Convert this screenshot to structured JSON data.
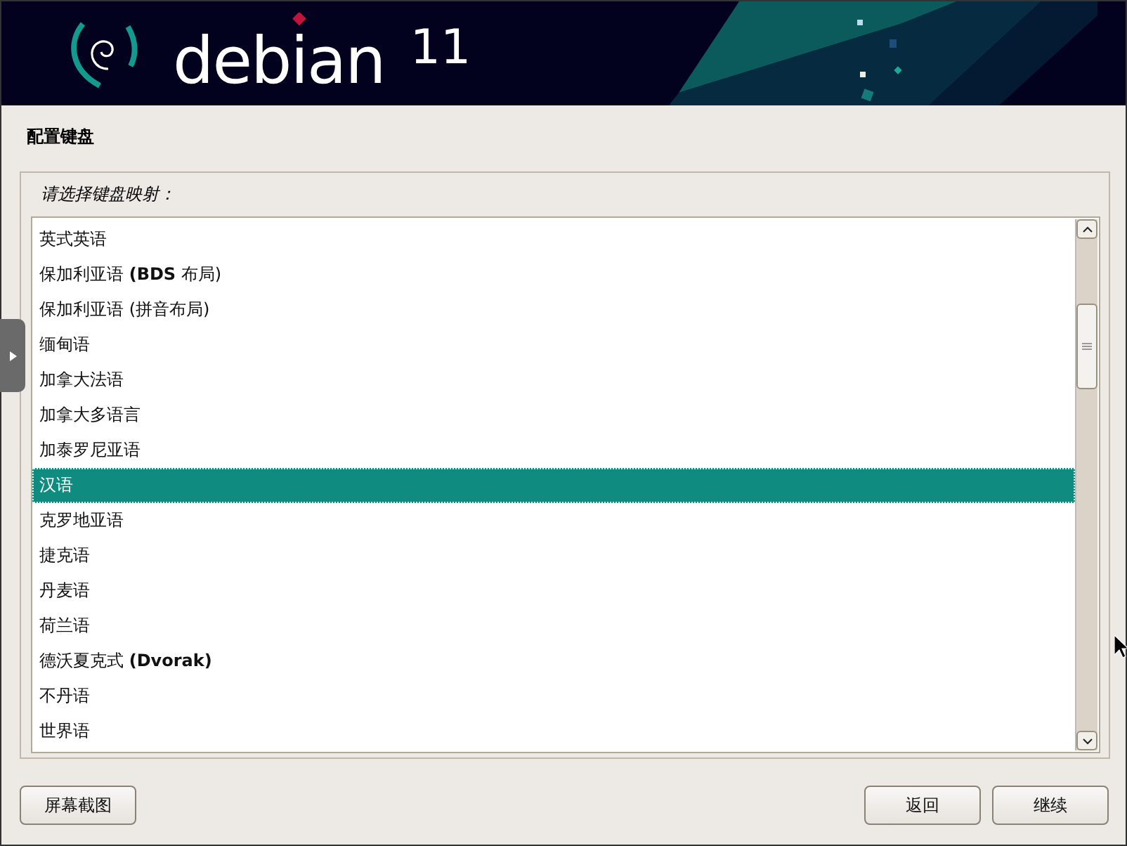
{
  "header": {
    "brand": "debian",
    "version": "11"
  },
  "title": "配置键盘",
  "prompt": "请选择键盘映射：",
  "options": [
    {
      "label": "英式英语",
      "selected": false
    },
    {
      "label": "保加利亚语 **(BDS** 布局)",
      "selected": false
    },
    {
      "label": "保加利亚语 (拼音布局)",
      "selected": false
    },
    {
      "label": "缅甸语",
      "selected": false
    },
    {
      "label": "加拿大法语",
      "selected": false
    },
    {
      "label": "加拿大多语言",
      "selected": false
    },
    {
      "label": "加泰罗尼亚语",
      "selected": false
    },
    {
      "label": "汉语",
      "selected": true
    },
    {
      "label": "克罗地亚语",
      "selected": false
    },
    {
      "label": "捷克语",
      "selected": false
    },
    {
      "label": "丹麦语",
      "selected": false
    },
    {
      "label": "荷兰语",
      "selected": false
    },
    {
      "label": "德沃夏克式 **(Dvorak)**",
      "selected": false
    },
    {
      "label": "不丹语",
      "selected": false
    },
    {
      "label": "世界语",
      "selected": false
    }
  ],
  "buttons": {
    "left": [
      "屏幕截图"
    ],
    "right": [
      "返回",
      "继续"
    ]
  }
}
